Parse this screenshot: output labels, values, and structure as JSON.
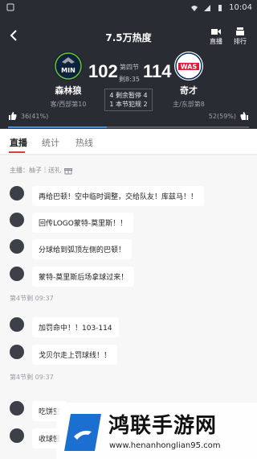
{
  "status_bar": {
    "time": "10:04"
  },
  "header": {
    "title": "7.5万热度",
    "actions": [
      {
        "label": "直播",
        "icon": "camera-icon"
      },
      {
        "label": "排行",
        "icon": "trophy-icon"
      }
    ]
  },
  "game": {
    "home": {
      "name": "森林狼",
      "sub": "客/西部第10",
      "score": "102",
      "logo_text": "MIN",
      "logo_color": "#0c2340"
    },
    "away": {
      "name": "奇才",
      "sub": "主/东部第8",
      "score": "114",
      "logo_text": "WAS",
      "logo_color": "#e31837"
    },
    "period": "第四节",
    "clock": "剩8:35",
    "info_line1": "4 剩余暂停 4",
    "info_line2": "1 本节犯规 2"
  },
  "votes": {
    "left": "36(41%)",
    "right": "52(59%)",
    "left_fraction": 0.41,
    "accent": "#4a90d9"
  },
  "tabs": [
    {
      "label": "直播",
      "active": true
    },
    {
      "label": "统计",
      "active": false
    },
    {
      "label": "热线",
      "active": false
    }
  ],
  "feed": {
    "host": "主播：柚子｜送礼",
    "messages": [
      {
        "type": "msg",
        "text": "再给巴顿！空中临时调整，交给队友！库兹马！！"
      },
      {
        "type": "msg",
        "text": "回传LOGO蒙特-莫里斯！！"
      },
      {
        "type": "msg",
        "text": "分球给到弧顶左侧的巴顿！"
      },
      {
        "type": "msg",
        "text": "蒙特-莫里斯后场拿球过来！"
      },
      {
        "type": "time",
        "text": "第4节剩 09:37"
      },
      {
        "type": "msg",
        "text": "加罚命中！！103-114"
      },
      {
        "type": "msg",
        "text": "戈贝尔走上罚球线！！"
      },
      {
        "type": "time",
        "text": "第4节剩 09:37"
      },
      {
        "type": "msg",
        "text": "吃饼空"
      },
      {
        "type": "msg",
        "text": "收球慢"
      }
    ]
  },
  "watermark": {
    "title": "鸿联手游网",
    "url": "www.henanhonglian95.com"
  }
}
